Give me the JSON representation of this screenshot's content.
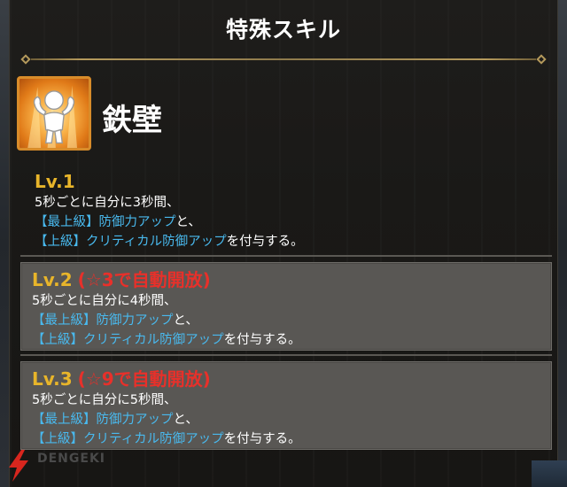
{
  "title": "特殊スキル",
  "skill": {
    "name": "鉄壁",
    "icon": "flexing-figure-icon"
  },
  "levels": [
    {
      "label": "Lv.1",
      "unlock": "",
      "line1": "5秒ごとに自分に3秒間、",
      "buff1": "【最上級】防御力アップ",
      "buff1_suffix": "と、",
      "buff2": "【上級】クリティカル防御アップ",
      "buff2_suffix": "を付与する。"
    },
    {
      "label": "Lv.2",
      "unlock": "(☆3で自動開放)",
      "line1": "5秒ごとに自分に4秒間、",
      "buff1": "【最上級】防御力アップ",
      "buff1_suffix": "と、",
      "buff2": "【上級】クリティカル防御アップ",
      "buff2_suffix": "を付与する。"
    },
    {
      "label": "Lv.3",
      "unlock": "(☆9で自動開放)",
      "line1": "5秒ごとに自分に5秒間、",
      "buff1": "【最上級】防御力アップ",
      "buff1_suffix": "と、",
      "buff2": "【上級】クリティカル防御アップ",
      "buff2_suffix": "を付与する。"
    }
  ],
  "watermark": {
    "text": "DENGEKI"
  },
  "colors": {
    "level_label": "#e8b52a",
    "unlock": "#e8302a",
    "buff": "#49b9ee",
    "divider_gold": "#b59a5c"
  }
}
